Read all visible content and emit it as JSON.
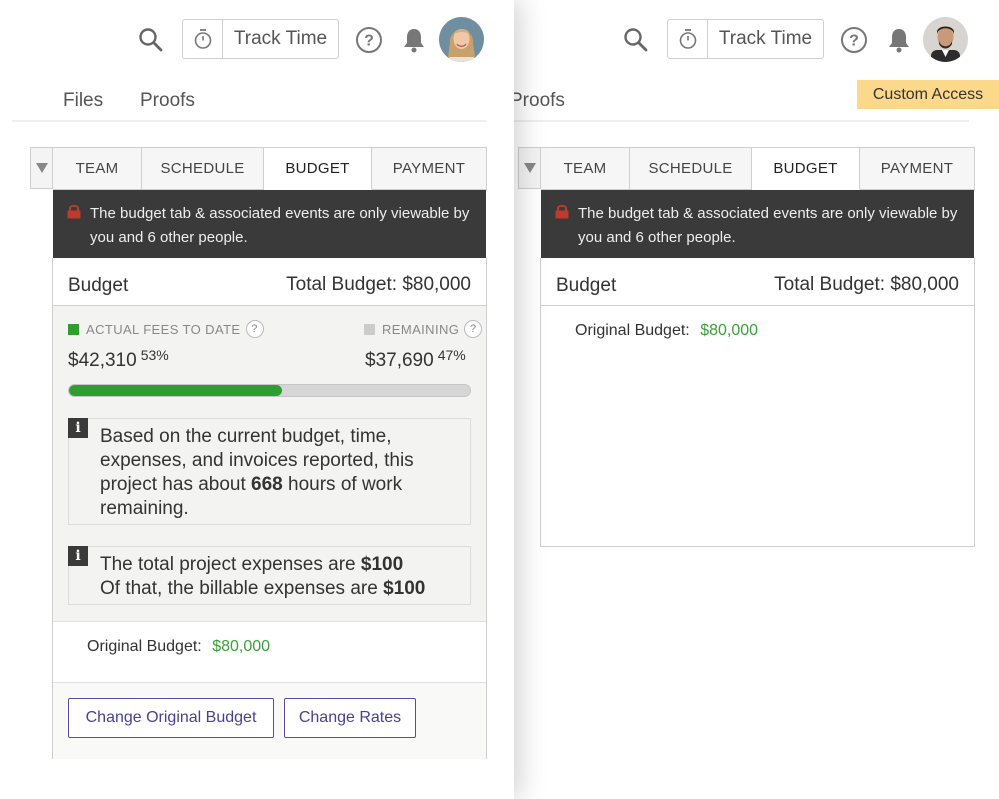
{
  "header": {
    "track_time_label": "Track Time"
  },
  "left": {
    "subnav": {
      "files_label": "Files",
      "proofs_label": "Proofs"
    },
    "tabs": [
      "TEAM",
      "SCHEDULE",
      "BUDGET",
      "PAYMENT"
    ],
    "active_tab": "BUDGET",
    "privacy_notice": "The budget tab & associated events are only viewable by you and 6 other people.",
    "budget_label": "Budget",
    "total_budget": "Total Budget: $80,000",
    "fees": {
      "actual_label": "ACTUAL FEES TO DATE",
      "remaining_label": "REMAINING",
      "help_glyph": "?",
      "actual_amount": "$42,310",
      "actual_percent": "53%",
      "remaining_amount": "$37,690",
      "remaining_percent": "47%",
      "progress_fraction": 0.53,
      "actual_color": "#2e9e2e",
      "remaining_color": "#cccccc"
    },
    "info_hours": {
      "badge": "i",
      "text_before": "Based on the current budget, time, expenses, and invoices reported, this project has about ",
      "hours": "668",
      "text_after": " hours of work remaining."
    },
    "info_expenses": {
      "badge": "i",
      "line1_text": "The total project expenses are ",
      "line1_value": "$100",
      "line2_text": "Of that, the billable expenses are ",
      "line2_value": "$100"
    },
    "original_budget_label": "Original Budget:",
    "original_budget_value": "$80,000",
    "change_budget_label": "Change Original Budget",
    "change_rates_label": "Change Rates"
  },
  "right": {
    "proofs_label": "Proofs",
    "custom_access_label": "Custom Access",
    "tabs": [
      "TEAM",
      "SCHEDULE",
      "BUDGET",
      "PAYMENT"
    ],
    "active_tab": "BUDGET",
    "privacy_notice": "The budget tab & associated events are only viewable by you and 6 other people.",
    "budget_label": "Budget",
    "total_budget": "Total Budget: $80,000",
    "original_budget_label": "Original Budget:",
    "original_budget_value": "$80,000"
  },
  "colors": {
    "accent_green": "#3aa13a",
    "button_purple": "#4a3f9a",
    "notice_bg": "#3a3a3a",
    "badge_yellow": "#fbd88a",
    "lock_red": "#c0392b"
  },
  "icons": {
    "search": "search-icon",
    "stopwatch": "stopwatch-icon",
    "help": "help-circle-icon",
    "bell": "bell-icon",
    "lock": "lock-icon",
    "info": "info-icon",
    "dropdown": "triangle-down-icon"
  }
}
